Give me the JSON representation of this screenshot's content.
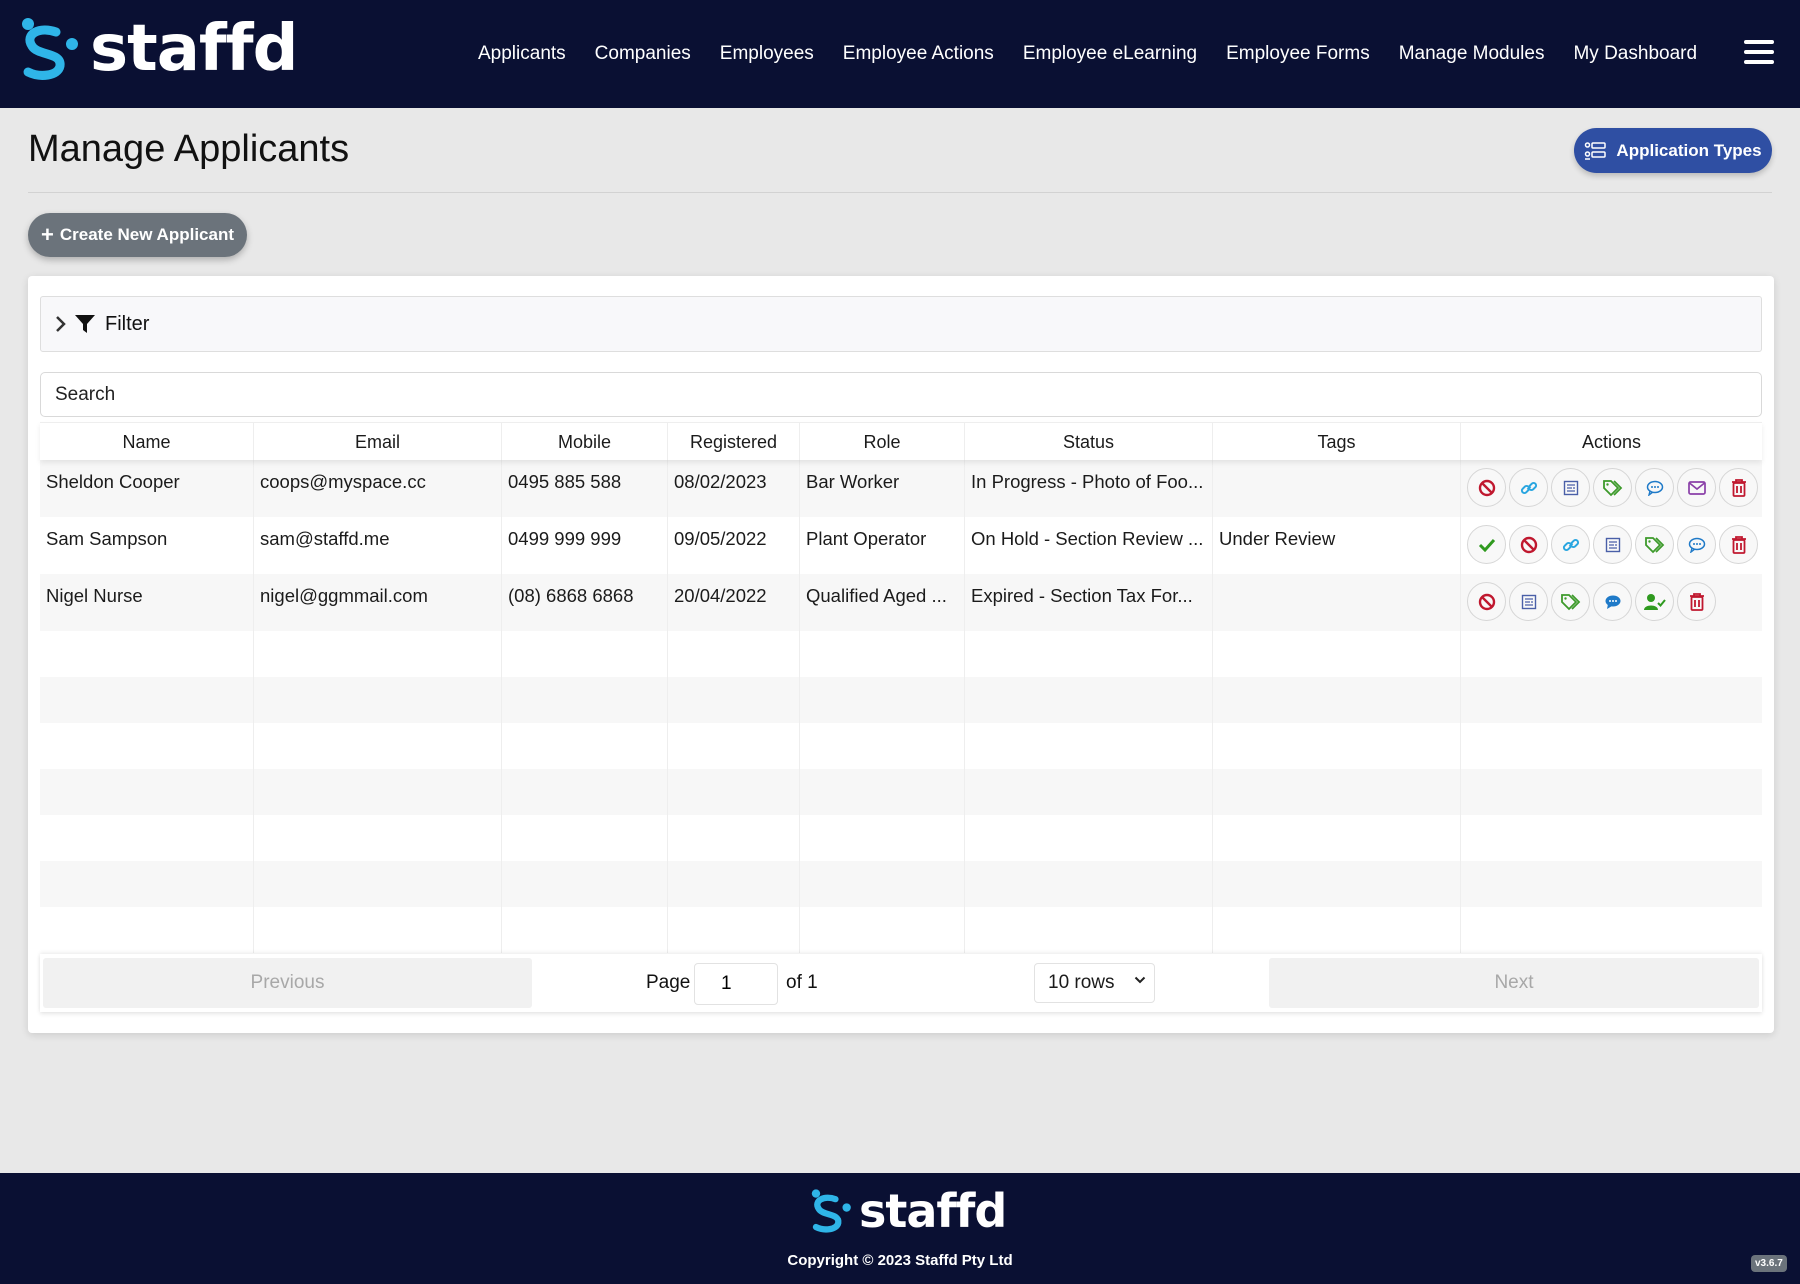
{
  "brand": {
    "name": "staffd",
    "accent": "#2fb5e8",
    "nav_bg": "#0a1033"
  },
  "nav": {
    "items": [
      {
        "label": "Applicants"
      },
      {
        "label": "Companies"
      },
      {
        "label": "Employees"
      },
      {
        "label": "Employee Actions"
      },
      {
        "label": "Employee eLearning"
      },
      {
        "label": "Employee Forms"
      },
      {
        "label": "Manage Modules"
      },
      {
        "label": "My Dashboard"
      }
    ],
    "menu_icon": "hamburger-icon"
  },
  "page": {
    "title": "Manage Applicants",
    "application_types_label": "Application Types",
    "create_label": "Create New Applicant"
  },
  "filter": {
    "label": "Filter"
  },
  "search": {
    "placeholder": "Search",
    "value": ""
  },
  "table": {
    "columns": [
      "Name",
      "Email",
      "Mobile",
      "Registered",
      "Role",
      "Status",
      "Tags",
      "Actions"
    ],
    "rows": [
      {
        "name": "Sheldon Cooper",
        "email": "coops@myspace.cc",
        "mobile": "0495 885 588",
        "registered": "08/02/2023",
        "role": "Bar Worker",
        "status": "In Progress - Photo of Foo...",
        "tags": "",
        "actions": [
          "block",
          "link",
          "form",
          "tags",
          "comment",
          "email",
          "delete"
        ]
      },
      {
        "name": "Sam Sampson",
        "email": "sam@staffd.me",
        "mobile": "0499 999 999",
        "registered": "09/05/2022",
        "role": "Plant Operator",
        "status": "On Hold - Section Review ...",
        "tags": "Under Review",
        "actions": [
          "approve",
          "block",
          "link",
          "form",
          "tags",
          "comment",
          "delete"
        ]
      },
      {
        "name": "Nigel Nurse",
        "email": "nigel@ggmmail.com",
        "mobile": "(08) 6868 6868",
        "registered": "20/04/2022",
        "role": "Qualified Aged ...",
        "status": "Expired - Section Tax For...",
        "tags": "",
        "actions": [
          "block",
          "form",
          "tags",
          "comment-filled",
          "convert-employee",
          "delete"
        ]
      }
    ]
  },
  "pagination": {
    "previous_label": "Previous",
    "next_label": "Next",
    "page_label": "Page",
    "current_page": "1",
    "of_label": "of 1",
    "rows_option": "10 rows"
  },
  "footer": {
    "copyright": "Copyright © 2023 Staffd Pty Ltd",
    "version": "v3.6.7"
  }
}
